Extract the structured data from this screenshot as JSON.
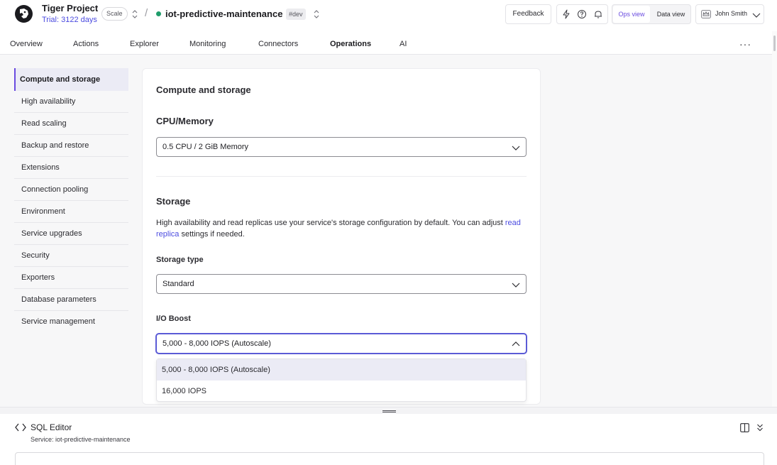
{
  "header": {
    "project_name": "Tiger Project",
    "trial": "Trial: 3122 days",
    "plan": "Scale",
    "separator": "/",
    "service_name": "iot-predictive-maintenance",
    "env_tag": "#dev",
    "feedback_label": "Feedback",
    "ops_view_label": "Ops view",
    "data_view_label": "Data view",
    "user_name": "John Smith",
    "status_color": "#1f9d6b",
    "accent_color": "#6a4be0"
  },
  "tabs": [
    {
      "label": "Overview"
    },
    {
      "label": "Actions"
    },
    {
      "label": "Explorer"
    },
    {
      "label": "Monitoring"
    },
    {
      "label": "Connectors"
    },
    {
      "label": "Operations",
      "active": true
    },
    {
      "label": "AI"
    }
  ],
  "more_label": "···",
  "sidebar": {
    "items": [
      {
        "label": "Compute and storage",
        "active": true
      },
      {
        "label": "High availability"
      },
      {
        "label": "Read scaling"
      },
      {
        "label": "Backup and restore"
      },
      {
        "label": "Extensions"
      },
      {
        "label": "Connection pooling"
      },
      {
        "label": "Environment"
      },
      {
        "label": "Service upgrades"
      },
      {
        "label": "Security"
      },
      {
        "label": "Exporters"
      },
      {
        "label": "Database parameters"
      },
      {
        "label": "Service management"
      }
    ]
  },
  "content": {
    "title": "Compute and storage",
    "cpu_memory": {
      "heading": "CPU/Memory",
      "value": "0.5 CPU / 2 GiB Memory"
    },
    "storage": {
      "heading": "Storage",
      "description_before": "High availability and read replicas use your service's storage configuration by default. You can adjust ",
      "description_link": "read replica",
      "description_after": " settings if needed.",
      "type_label": "Storage type",
      "type_value": "Standard",
      "io_boost_label": "I/O Boost",
      "io_boost_value": "5,000 - 8,000 IOPS (Autoscale)",
      "io_boost_options": [
        {
          "label": "5,000 - 8,000 IOPS (Autoscale)",
          "selected": true
        },
        {
          "label": "16,000 IOPS"
        }
      ]
    }
  },
  "sql_editor": {
    "title": "SQL Editor",
    "service": "Service: iot-predictive-maintenance"
  },
  "icons": [
    "tiger-logo-icon",
    "updown-icon",
    "lightning-icon",
    "help-icon",
    "bell-icon",
    "crown-icon",
    "chevron-down-icon",
    "chevron-up-icon",
    "code-icon",
    "panel-icon",
    "double-chevron-down-icon",
    "resize-grip-icon"
  ]
}
